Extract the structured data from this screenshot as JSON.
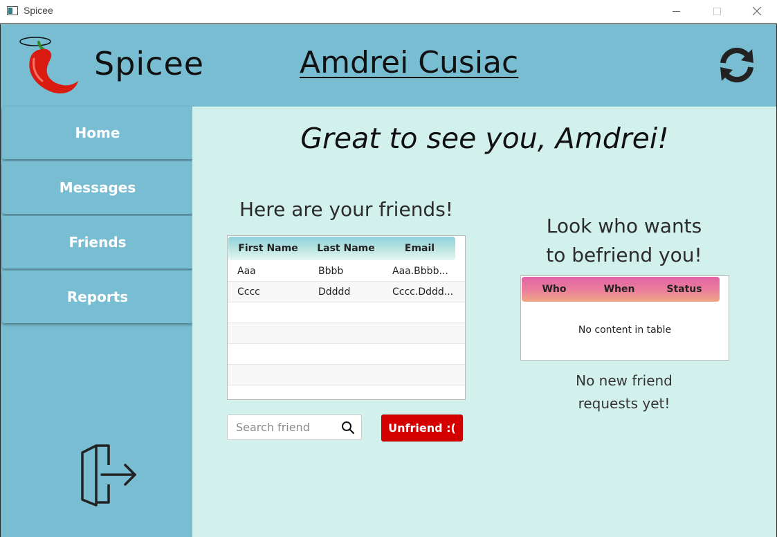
{
  "window": {
    "title": "Spicee"
  },
  "header": {
    "brand": "Spicee",
    "user_name": "Amdrei Cusiac"
  },
  "sidebar": {
    "items": [
      {
        "label": "Home"
      },
      {
        "label": "Messages"
      },
      {
        "label": "Friends"
      },
      {
        "label": "Reports"
      }
    ]
  },
  "main": {
    "greeting": "Great to see you, Amdrei!",
    "friends_title": "Here are your friends!",
    "friends_table": {
      "columns": [
        "First Name",
        "Last Name",
        "Email"
      ],
      "rows": [
        [
          "Aaa",
          "Bbbb",
          "Aaa.Bbbb..."
        ],
        [
          "Cccc",
          "Ddddd",
          "Cccc.Dddd..."
        ]
      ]
    },
    "search": {
      "placeholder": "Search friend"
    },
    "unfriend_label": "Unfriend :(",
    "requests_title_line1": "Look who wants",
    "requests_title_line2": "to befriend you!",
    "requests_table": {
      "columns": [
        "Who",
        "When",
        "Status"
      ],
      "empty_text": "No content in table"
    },
    "no_requests_line1": "No new friend",
    "no_requests_line2": "requests yet!"
  },
  "colors": {
    "sidebar_bg": "#78bdd1",
    "main_bg": "#d3f1ec",
    "unfriend_bg": "#d40000",
    "requests_header": "#e163a5",
    "friends_header": "#8fd1df"
  }
}
